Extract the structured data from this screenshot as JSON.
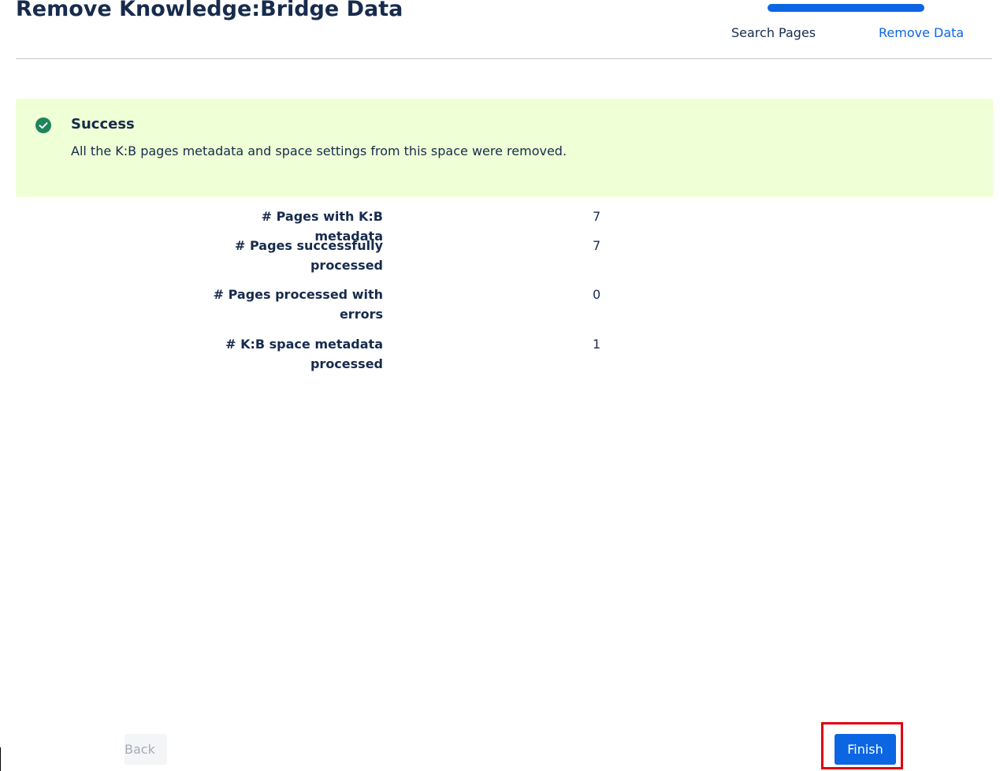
{
  "header": {
    "title": "Remove Knowledge:Bridge Data"
  },
  "wizard": {
    "steps": [
      {
        "label": "Search Pages"
      },
      {
        "label": "Remove Data"
      }
    ],
    "progress": 1.0,
    "accent_color": "#0c66e4"
  },
  "banner": {
    "icon": "check-circle-icon",
    "title": "Success",
    "message": "All the K:B pages metadata and space settings from this space were removed.",
    "background_color": "#efffd6",
    "icon_color": "#1f845a"
  },
  "stats": [
    {
      "label": "# Pages with K:B metadata",
      "value": "7"
    },
    {
      "label": "# Pages successfully processed",
      "value": "7"
    },
    {
      "label": "# Pages processed with errors",
      "value": "0"
    },
    {
      "label": "# K:B space metadata processed",
      "value": "1"
    }
  ],
  "footer": {
    "back_label": "Back",
    "finish_label": "Finish",
    "highlight_color": "#e0000f"
  }
}
